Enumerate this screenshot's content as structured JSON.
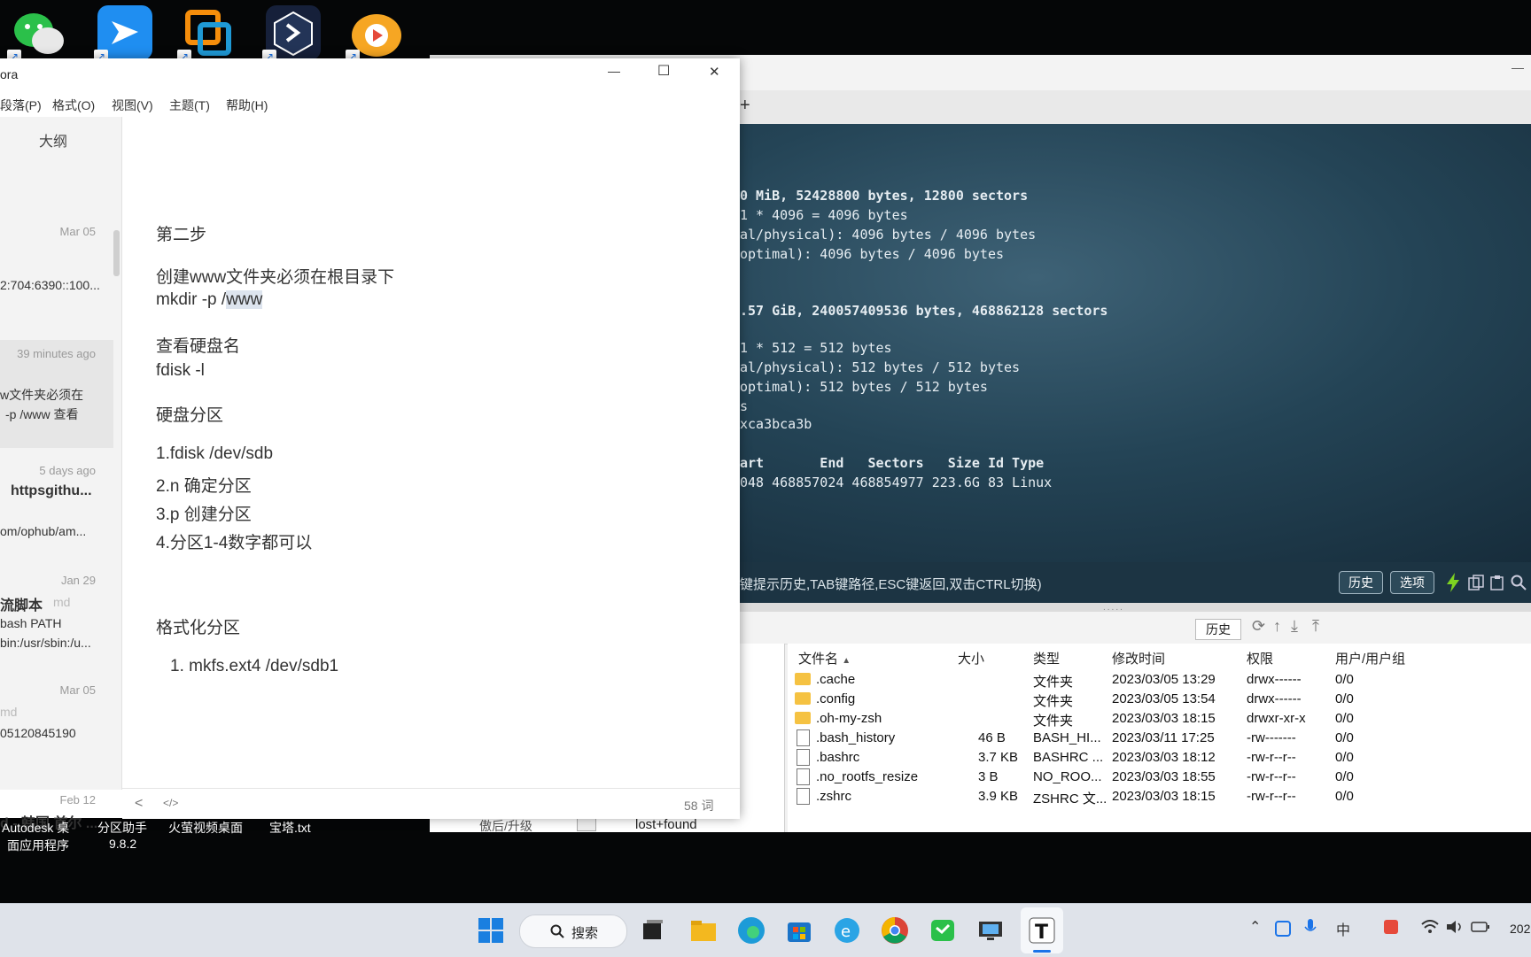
{
  "desktop": {
    "icons": [
      "wechat-icon",
      "feishu-icon",
      "vmware-icon",
      "git-client-icon",
      "video-app-icon"
    ],
    "labels": [
      {
        "line1": "Autodesk 桌",
        "line2": "面应用程序"
      },
      {
        "line1": "分区助手",
        "line2": "9.8.2"
      },
      {
        "line1": "火萤视频桌面",
        "line2": ""
      },
      {
        "line1": "宝塔.txt",
        "line2": ""
      }
    ]
  },
  "typora": {
    "title": "ora",
    "controls": {
      "minimize": "—",
      "maximize": "☐",
      "close": "✕"
    },
    "menu": [
      "段落(P)",
      "格式(O)",
      "视图(V)",
      "主题(T)",
      "帮助(H)"
    ],
    "sidebar": {
      "header": "大纲",
      "items": [
        {
          "date": "Mar 05",
          "title": "",
          "line1": "2:704:6390::100...",
          "line2": ""
        },
        {
          "date": "39 minutes ago",
          "title": "",
          "line1": "w文件夹必须在",
          "line2": "-p /www 查看"
        },
        {
          "date": "5 days ago",
          "title": "httpsgithu...",
          "line1": "om/ophub/am...",
          "line2": ""
        },
        {
          "date": "Jan 29",
          "title": "流脚本",
          "title_suffix": "md",
          "line1": "bash PATH",
          "line2": "bin:/usr/sbin:/u..."
        },
        {
          "date": "Mar 05",
          "title": "",
          "title_suffix": "md",
          "line1": "05120845190",
          "line2": ""
        },
        {
          "date": "Feb 12",
          "title": "d - 韩国 首尔 ...",
          "line1": "",
          "line2": ""
        }
      ]
    },
    "editor": {
      "step": "第二步",
      "mk_desc": "创建www文件夹必须在根目录下",
      "mk_cmd_prefix": "mkdir -p /",
      "mk_cmd_sel": "www",
      "disk_title": "查看硬盘名",
      "disk_cmd": "fdisk -l",
      "part_title": "硬盘分区",
      "part_steps": [
        "1.fdisk /dev/sdb",
        "2.n 确定分区",
        "3.p 创建分区",
        "4.分区1-4数字都可以"
      ],
      "fmt_title": "格式化分区",
      "fmt_step": "1. mkfs.ext4 /dev/sdb1"
    },
    "footer": {
      "back": "<",
      "source": "</>",
      "words": "58 词"
    }
  },
  "ssh": {
    "tab_add": "+",
    "terminal_lines": [
      {
        "text": "0 MiB, 52428800 bytes, 12800 sectors",
        "bold": true
      },
      {
        "text": "1 * 4096 = 4096 bytes",
        "bold": false
      },
      {
        "text": "al/physical): 4096 bytes / 4096 bytes",
        "bold": false
      },
      {
        "text": "optimal): 4096 bytes / 4096 bytes",
        "bold": false
      },
      {
        "text": ".57 GiB, 240057409536 bytes, 468862128 sectors",
        "bold": true
      },
      {
        "text": "1 * 512 = 512 bytes",
        "bold": false
      },
      {
        "text": "al/physical): 512 bytes / 512 bytes",
        "bold": false
      },
      {
        "text": "optimal): 512 bytes / 512 bytes",
        "bold": false
      },
      {
        "text": "s",
        "bold": false
      },
      {
        "text": "xca3bca3b",
        "bold": false
      },
      {
        "text": "art       End   Sectors   Size Id Type",
        "bold": true
      },
      {
        "text": "048 468857024 468854977 223.6G 83 Linux",
        "bold": false
      }
    ],
    "hint": "键提示历史,TAB键路径,ESC键返回,双击CTRL切换)",
    "history_btn": "历史",
    "options_btn": "选项",
    "fm_history_btn": "历史",
    "left_items": [
      "傲后/升级",
      "lost+found"
    ],
    "columns": [
      "文件名",
      "大小",
      "类型",
      "修改时间",
      "权限",
      "用户/用户组"
    ],
    "files": [
      {
        "name": ".cache",
        "size": "",
        "type": "文件夹",
        "mtime": "2023/03/05 13:29",
        "perm": "drwx------",
        "owner": "0/0",
        "kind": "folder"
      },
      {
        "name": ".config",
        "size": "",
        "type": "文件夹",
        "mtime": "2023/03/05 13:54",
        "perm": "drwx------",
        "owner": "0/0",
        "kind": "folder"
      },
      {
        "name": ".oh-my-zsh",
        "size": "",
        "type": "文件夹",
        "mtime": "2023/03/03 18:15",
        "perm": "drwxr-xr-x",
        "owner": "0/0",
        "kind": "folder"
      },
      {
        "name": ".bash_history",
        "size": "46 B",
        "type": "BASH_HI...",
        "mtime": "2023/03/11 17:25",
        "perm": "-rw-------",
        "owner": "0/0",
        "kind": "file"
      },
      {
        "name": ".bashrc",
        "size": "3.7 KB",
        "type": "BASHRC ...",
        "mtime": "2023/03/03 18:12",
        "perm": "-rw-r--r--",
        "owner": "0/0",
        "kind": "file"
      },
      {
        "name": ".no_rootfs_resize",
        "size": "3 B",
        "type": "NO_ROO...",
        "mtime": "2023/03/03 18:55",
        "perm": "-rw-r--r--",
        "owner": "0/0",
        "kind": "file"
      },
      {
        "name": ".zshrc",
        "size": "3.9 KB",
        "type": "ZSHRC 文...",
        "mtime": "2023/03/03 18:15",
        "perm": "-rw-r--r--",
        "owner": "0/0",
        "kind": "file"
      }
    ]
  },
  "taskbar": {
    "search_label": "搜索",
    "clock_partial": "202"
  }
}
